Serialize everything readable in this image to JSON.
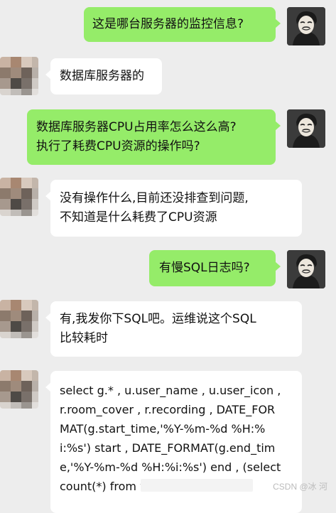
{
  "chat": {
    "messages": [
      {
        "side": "me",
        "text": "这是哪台服务器的监控信息?"
      },
      {
        "side": "other",
        "text": "数据库服务器的"
      },
      {
        "side": "me",
        "text": "数据库服务器CPU占用率怎么这么高?\n执行了耗费CPU资源的操作吗?"
      },
      {
        "side": "other",
        "text": "没有操作什么,目前还没排查到问题,\n不知道是什么耗费了CPU资源"
      },
      {
        "side": "me",
        "text": "有慢SQL日志吗?"
      },
      {
        "side": "other",
        "text": "有,我发你下SQL吧。运维说这个SQL\n比较耗时"
      },
      {
        "side": "other",
        "text": "select g.* , u.user_name , u.user_icon ,\nr.room_cover , r.recording , DATE_FOR\nMAT(g.start_time,'%Y-%m-%d %H:%\ni:%s') start , DATE_FORMAT(g.end_tim\ne,'%Y-%m-%d %H:%i:%s') end , (select\ncount(*) from                            where"
      }
    ]
  },
  "watermark": "CSDN @冰 河",
  "colors": {
    "background": "#ededed",
    "self_bubble": "#95ec69",
    "other_bubble": "#ffffff",
    "self_avatar": "#3a3a3a"
  }
}
